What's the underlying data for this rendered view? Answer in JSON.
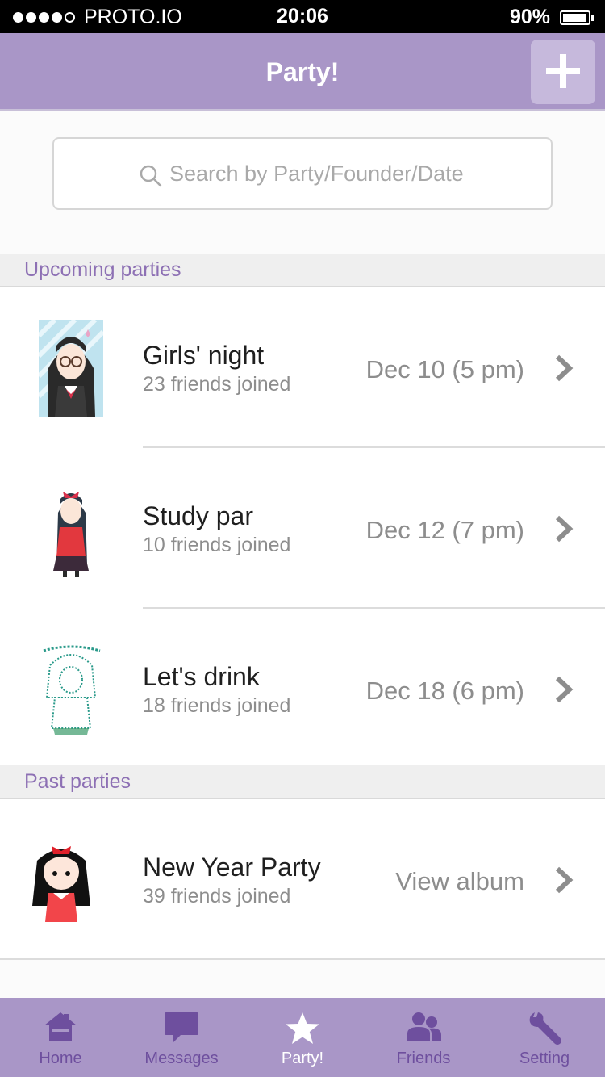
{
  "status_bar": {
    "carrier": "PROTO.IO",
    "time": "20:06",
    "battery": "90%"
  },
  "nav": {
    "title": "Party!",
    "add_icon": "plus-icon"
  },
  "search": {
    "placeholder": "Search by Party/Founder/Date",
    "icon": "search-icon"
  },
  "sections": {
    "upcoming": {
      "title": "Upcoming parties",
      "items": [
        {
          "title": "Girls' night",
          "subtitle": "23 friends joined",
          "date": "Dec 10 (5 pm)"
        },
        {
          "title": "Study par",
          "subtitle": "10 friends joined",
          "date": "Dec 12 (7 pm)"
        },
        {
          "title": "Let's drink",
          "subtitle": "18 friends joined",
          "date": "Dec 18 (6 pm)"
        }
      ]
    },
    "past": {
      "title": "Past parties",
      "items": [
        {
          "title": "New Year Party",
          "subtitle": "39 friends joined",
          "action": "View album"
        }
      ]
    }
  },
  "tabs": [
    {
      "label": "Home",
      "icon": "home-icon"
    },
    {
      "label": "Messages",
      "icon": "message-icon"
    },
    {
      "label": "Party!",
      "icon": "star-icon",
      "active": true
    },
    {
      "label": "Friends",
      "icon": "friends-icon"
    },
    {
      "label": "Setting",
      "icon": "wrench-icon"
    }
  ],
  "colors": {
    "brand": "#a996c7",
    "accent_text": "#8d70b4",
    "tab_inactive": "#6e4f9e"
  }
}
